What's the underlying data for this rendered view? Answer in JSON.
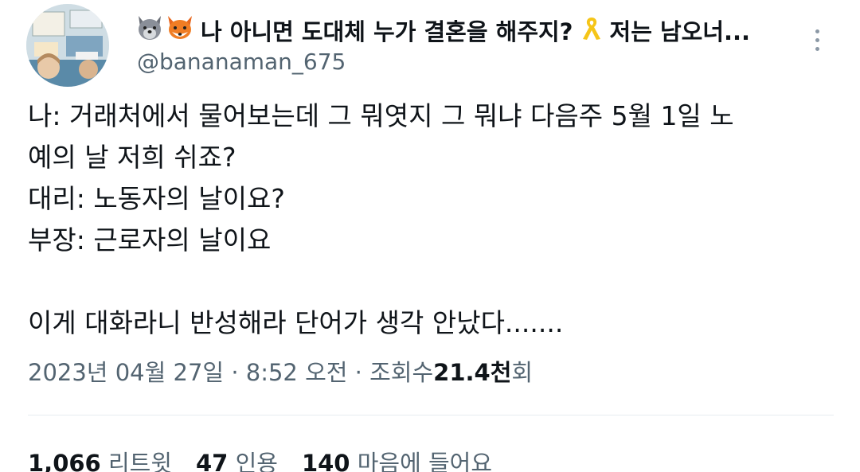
{
  "header": {
    "display_name_part1": "나 아니면 도대체 누가 결혼을 해주지?",
    "display_name_part2": "저는 남오너...",
    "handle": "@bananaman_675"
  },
  "body": {
    "lines": [
      "나: 거래처에서 물어보는데 그 뭐엿지 그 뭐냐 다음주 5월 1일 노",
      "예의 날 저희 쉬죠?",
      "대리: 노동자의 날이요?",
      "부장: 근로자의 날이요",
      "",
      "이게 대화라니 반성해라 단어가 생각 안났다......."
    ]
  },
  "meta": {
    "date": "2023년 04월 27일",
    "sep1": "·",
    "time": "8:52 오전",
    "sep2": "·",
    "views_label": "조회수",
    "views_value": "21.4천",
    "views_suffix": "회"
  },
  "stats": {
    "retweets_value": "1,066",
    "retweets_label": "리트윗",
    "quotes_value": "47",
    "quotes_label": "인용",
    "likes_value": "140",
    "likes_label": "마음에 들어요"
  },
  "icons": {
    "emoji_1": "wolf-face-emoji",
    "emoji_2": "fox-face-emoji",
    "emoji_3": "yellow-ribbon-emoji",
    "more": "more-vertical-icon"
  },
  "colors": {
    "text_primary": "#0f1419",
    "text_secondary": "#536471",
    "divider": "#e6ecf0"
  }
}
